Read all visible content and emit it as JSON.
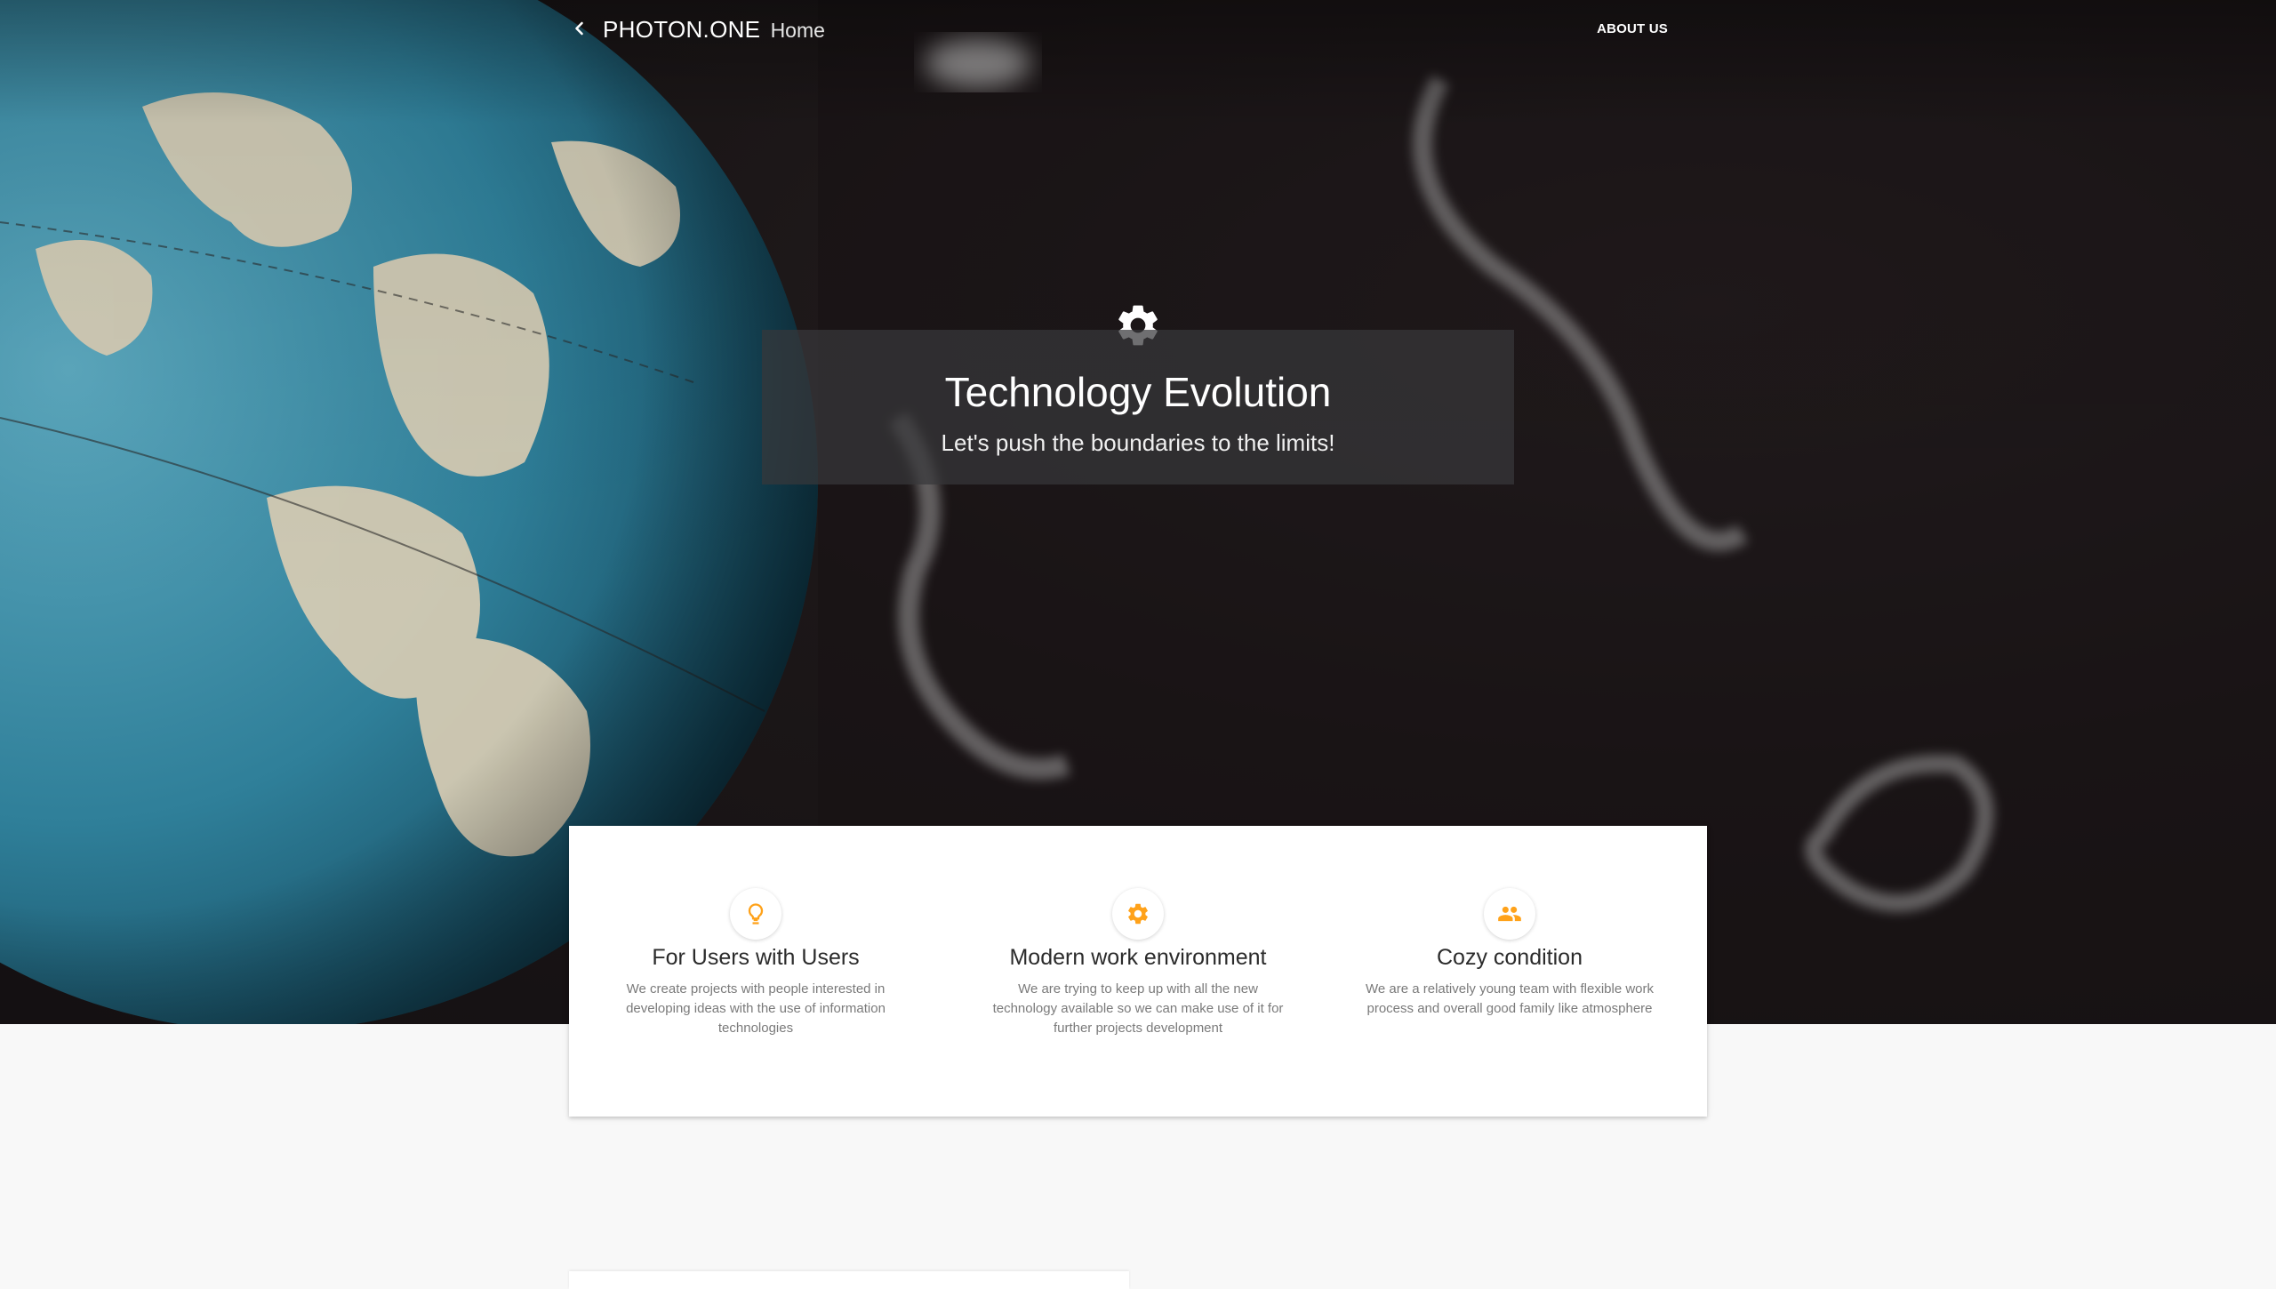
{
  "colors": {
    "accent": "#ffa21a",
    "hero_background": "#1c1718",
    "panel_background": "#37373a"
  },
  "nav": {
    "back_icon": "chevron-left-icon",
    "brand_name": "PHOTON.ONE",
    "brand_page": "Home",
    "about_link": "ABOUT US"
  },
  "hero": {
    "icon": "gear-icon",
    "title": "Technology Evolution",
    "subtitle": "Let's push the boundaries to the limits!"
  },
  "features": [
    {
      "icon": "lightbulb-icon",
      "title": "For Users with Users",
      "text": "We create projects with people interested in developing ideas with the use of information technologies"
    },
    {
      "icon": "gear-icon",
      "title": "Modern work environment",
      "text": "We are trying to keep up with all the new technology available so we can make use of it for further projects development"
    },
    {
      "icon": "people-icon",
      "title": "Cozy condition",
      "text": "We are a relatively young team with flexible work process and overall good family like atmosphere"
    }
  ]
}
